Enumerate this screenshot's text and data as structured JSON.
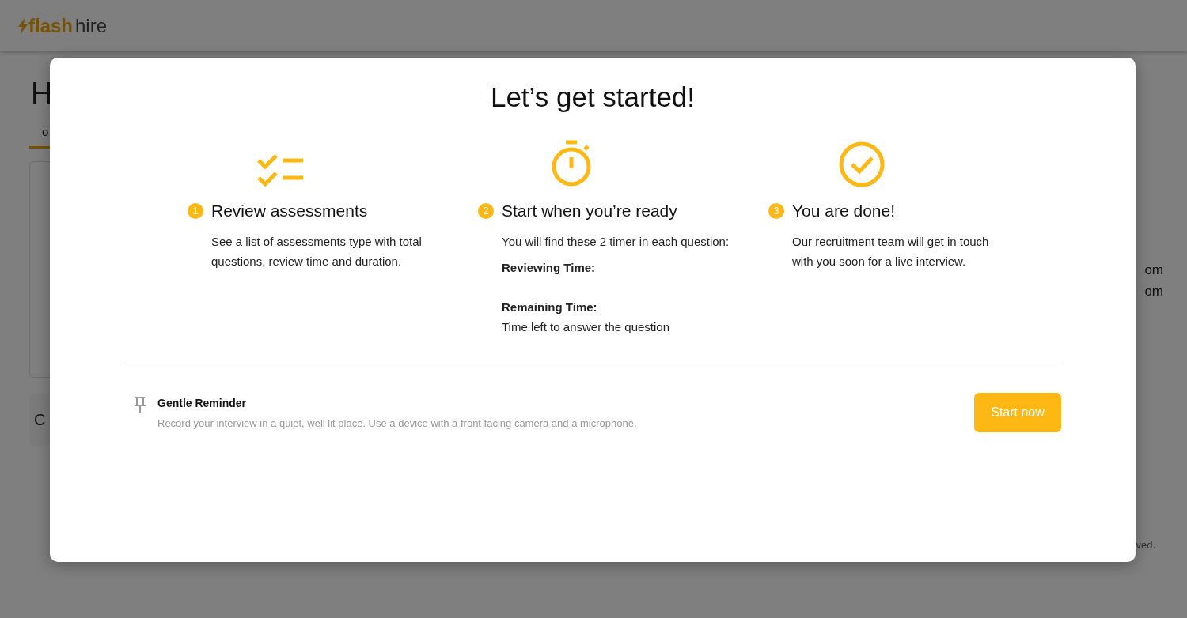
{
  "app": {
    "logo": {
      "accent": "flash",
      "rest": "hire"
    },
    "page_title": "H",
    "tab": "o",
    "card_title": "C",
    "right_lines": [
      "om",
      "om"
    ],
    "footer": "ved."
  },
  "modal": {
    "title": "Let’s get started!",
    "steps": [
      {
        "number": "1",
        "title": "Review assessments",
        "body": [
          {
            "kind": "text",
            "text": "See a list of assessments type with total questions, review time and duration."
          }
        ]
      },
      {
        "number": "2",
        "title": "Start when you’re ready",
        "body": [
          {
            "kind": "text",
            "text": "You will find these 2 timer in each question:"
          },
          {
            "kind": "label",
            "text": "Reviewing Time:"
          },
          {
            "kind": "label",
            "text": "Remaining Time:"
          },
          {
            "kind": "text",
            "text": "Time left to answer the question"
          }
        ]
      },
      {
        "number": "3",
        "title": "You are done!",
        "body": [
          {
            "kind": "text",
            "text": "Our recruitment team will get in touch with you soon for a live interview."
          }
        ]
      }
    ],
    "reminder": {
      "title": "Gentle Reminder",
      "text": "Record your interview in a quiet, well lit place. Use a device with a front facing camera and a microphone."
    },
    "button": "Start now"
  }
}
